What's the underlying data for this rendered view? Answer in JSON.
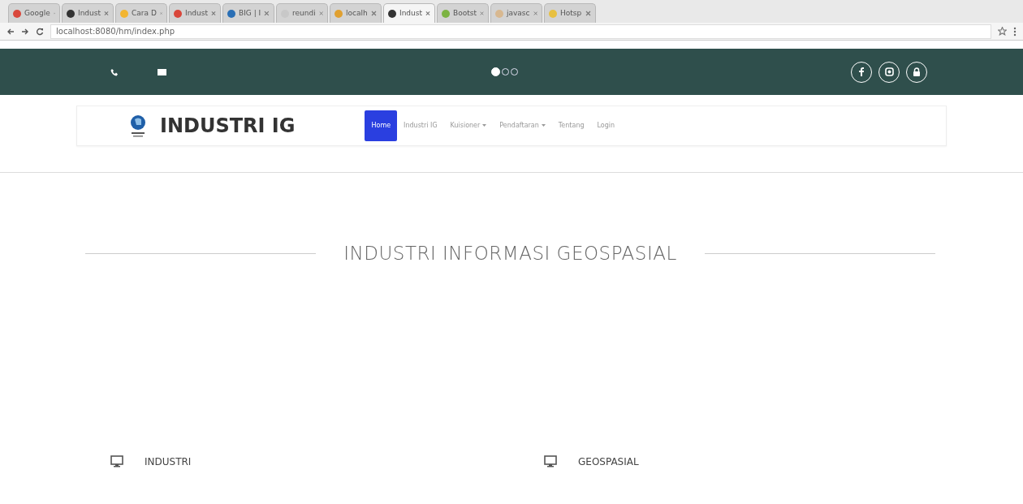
{
  "browser": {
    "tabs": [
      {
        "title": "Google",
        "selected": false,
        "color": "#d9473b"
      },
      {
        "title": "Indust",
        "selected": false,
        "color": "#333333"
      },
      {
        "title": "Cara D",
        "selected": false,
        "color": "#f2b531"
      },
      {
        "title": "Indust",
        "selected": false,
        "color": "#d9473b"
      },
      {
        "title": "BIG | I",
        "selected": false,
        "color": "#2a6fb5"
      },
      {
        "title": "reundi",
        "selected": false,
        "color": "#c8c8c8"
      },
      {
        "title": "localh",
        "selected": false,
        "color": "#e0a030"
      },
      {
        "title": "Indust",
        "selected": true,
        "color": "#333333"
      },
      {
        "title": "Bootst",
        "selected": false,
        "color": "#7cb342"
      },
      {
        "title": "javasc",
        "selected": false,
        "color": "#d8b890"
      },
      {
        "title": "Hotsp",
        "selected": false,
        "color": "#e8c040"
      }
    ],
    "address": "localhost:8080/hm/index.php"
  },
  "topbar": {
    "slides": [
      {
        "selected": true
      },
      {
        "selected": false
      },
      {
        "selected": false
      }
    ]
  },
  "navbar": {
    "brand": "INDUSTRI IG",
    "items": [
      {
        "label": "Home",
        "selected": true,
        "dropdown": false
      },
      {
        "label": "Industri IG",
        "selected": false,
        "dropdown": false
      },
      {
        "label": "Kuisioner",
        "selected": false,
        "dropdown": true
      },
      {
        "label": "Pendaftaran",
        "selected": false,
        "dropdown": true
      },
      {
        "label": "Tentang",
        "selected": false,
        "dropdown": false
      },
      {
        "label": "Login",
        "selected": false,
        "dropdown": false
      }
    ]
  },
  "heading": "INDUSTRI INFORMASI GEOSPASIAL",
  "features": [
    {
      "title": "INDUSTRI"
    },
    {
      "title": "GEOSPASIAL"
    }
  ]
}
